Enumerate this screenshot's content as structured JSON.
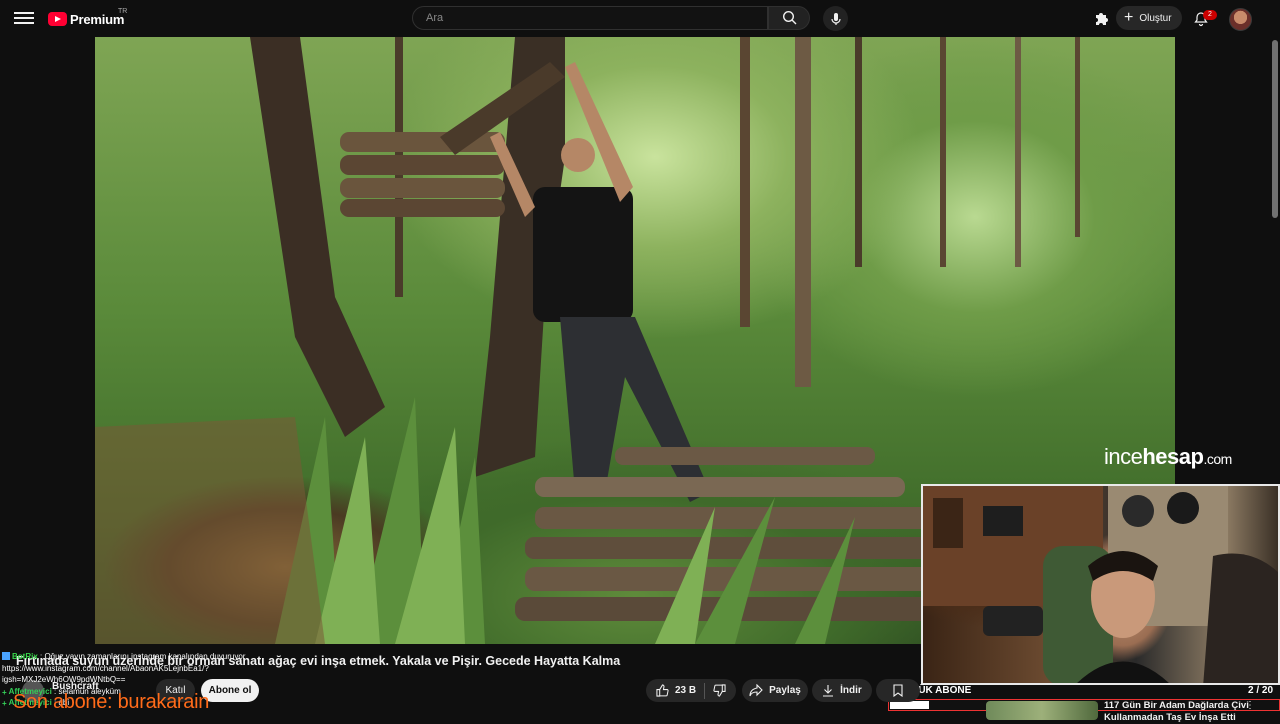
{
  "header": {
    "logo_text": "Premium",
    "logo_country": "TR",
    "search_placeholder": "Ara",
    "create_label": "Oluştur",
    "notification_count": "2"
  },
  "video": {
    "watermark_light": "ince",
    "watermark_bold": "hesap",
    "watermark_suffix": ".com",
    "title": "Fırtınada suyun üzerinde bir orman sanatı ağaç evi inşa etmek. Yakala ve Pişir. Gecede Hayatta Kalma",
    "channel_name": "Bushcraft",
    "channel_subs": "",
    "join_label": "Katıl",
    "subscribe_label": "Abone ol",
    "likes": "23 B",
    "share_label": "Paylaş",
    "download_label": "İndir"
  },
  "stream_overlay": {
    "goal_label": "GÜNLÜK ABONE",
    "goal_count": "2 / 20",
    "goal_progress": 0.1,
    "last_sub": "Son abone: burakarain",
    "chat": [
      {
        "name": "BotRix",
        "text": ": Oğuz yayın zamanlarını instagram kanalından duyuruyor",
        "color": "#38d64a"
      },
      {
        "name": "",
        "text": "https://www.instagram.com/channel/AbaonAK5LejnbEa1/?",
        "color": "#ffffff"
      },
      {
        "name": "",
        "text": "igsh=MXJ2eWh6OW9pdWNtbQ==",
        "color": "#ffffff"
      },
      {
        "name": "Affetmeyici",
        "text": ": selamün aleyküm",
        "color": "#34d058"
      },
      {
        "name": "Affetmeyici",
        "text": ": abi",
        "color": "#34d058"
      }
    ]
  },
  "recommended": {
    "title": "117 Gün Bir Adam Dağlarda Çivi Kullanmadan Taş Ev İnşa Etti",
    "more": "⋮"
  }
}
